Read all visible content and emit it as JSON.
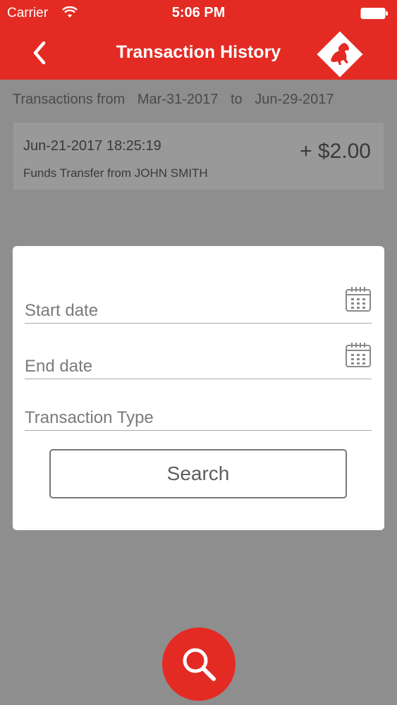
{
  "status_bar": {
    "carrier": "Carrier",
    "time": "5:06 PM"
  },
  "nav": {
    "title": "Transaction History"
  },
  "range": {
    "prefix": "Transactions from",
    "start": "Mar-31-2017",
    "to": "to",
    "end": "Jun-29-2017"
  },
  "transactions": [
    {
      "datetime": "Jun-21-2017 18:25:19",
      "description": "Funds Transfer from JOHN SMITH",
      "amount": "+ $2.00"
    }
  ],
  "filter": {
    "start_date_label": "Start date",
    "end_date_label": "End date",
    "type_label": "Transaction Type",
    "search_label": "Search"
  },
  "colors": {
    "brand_red": "#e32b24",
    "overlay": "#8e8e8e"
  },
  "icons": {
    "back": "chevron-left-icon",
    "logo": "horse-logo-icon",
    "calendar": "calendar-icon",
    "fab": "search-icon"
  }
}
